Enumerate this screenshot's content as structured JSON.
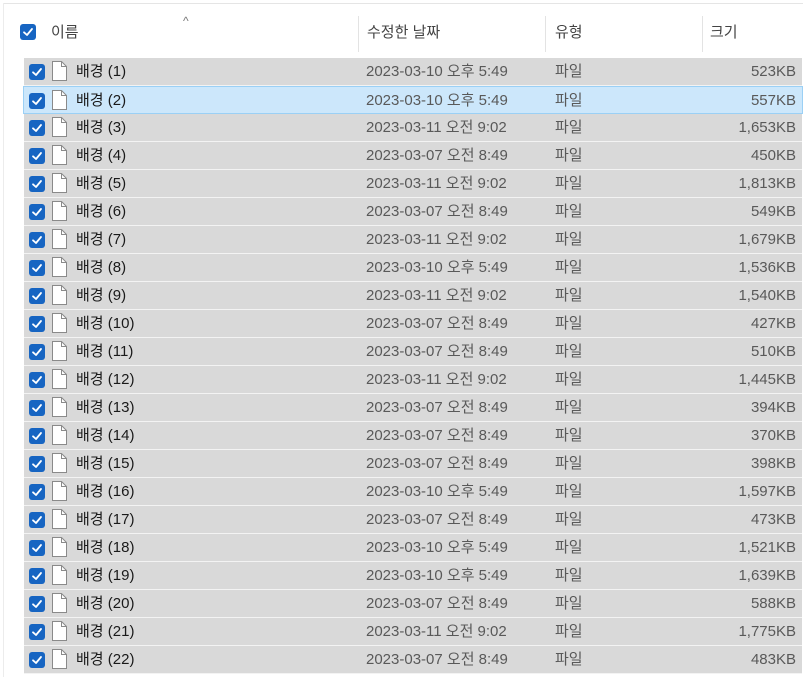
{
  "header": {
    "name": "이름",
    "date": "수정한 날짜",
    "type": "유형",
    "size": "크기"
  },
  "icons": {
    "sort": "chevron-up-icon",
    "checkbox": "checkbox-checked-icon",
    "file": "file-icon"
  },
  "colors": {
    "checkbox": "#1765c2",
    "selected_row": "#cce7fb",
    "row": "#d9d9d9"
  },
  "rows": [
    {
      "name": "배경 (1)",
      "date": "2023-03-10 오후 5:49",
      "type": "파일",
      "size": "523KB",
      "selected": false
    },
    {
      "name": "배경 (2)",
      "date": "2023-03-10 오후 5:49",
      "type": "파일",
      "size": "557KB",
      "selected": true
    },
    {
      "name": "배경 (3)",
      "date": "2023-03-11 오전 9:02",
      "type": "파일",
      "size": "1,653KB",
      "selected": false
    },
    {
      "name": "배경 (4)",
      "date": "2023-03-07 오전 8:49",
      "type": "파일",
      "size": "450KB",
      "selected": false
    },
    {
      "name": "배경 (5)",
      "date": "2023-03-11 오전 9:02",
      "type": "파일",
      "size": "1,813KB",
      "selected": false
    },
    {
      "name": "배경 (6)",
      "date": "2023-03-07 오전 8:49",
      "type": "파일",
      "size": "549KB",
      "selected": false
    },
    {
      "name": "배경 (7)",
      "date": "2023-03-11 오전 9:02",
      "type": "파일",
      "size": "1,679KB",
      "selected": false
    },
    {
      "name": "배경 (8)",
      "date": "2023-03-10 오후 5:49",
      "type": "파일",
      "size": "1,536KB",
      "selected": false
    },
    {
      "name": "배경 (9)",
      "date": "2023-03-11 오전 9:02",
      "type": "파일",
      "size": "1,540KB",
      "selected": false
    },
    {
      "name": "배경 (10)",
      "date": "2023-03-07 오전 8:49",
      "type": "파일",
      "size": "427KB",
      "selected": false
    },
    {
      "name": "배경 (11)",
      "date": "2023-03-07 오전 8:49",
      "type": "파일",
      "size": "510KB",
      "selected": false
    },
    {
      "name": "배경 (12)",
      "date": "2023-03-11 오전 9:02",
      "type": "파일",
      "size": "1,445KB",
      "selected": false
    },
    {
      "name": "배경 (13)",
      "date": "2023-03-07 오전 8:49",
      "type": "파일",
      "size": "394KB",
      "selected": false
    },
    {
      "name": "배경 (14)",
      "date": "2023-03-07 오전 8:49",
      "type": "파일",
      "size": "370KB",
      "selected": false
    },
    {
      "name": "배경 (15)",
      "date": "2023-03-07 오전 8:49",
      "type": "파일",
      "size": "398KB",
      "selected": false
    },
    {
      "name": "배경 (16)",
      "date": "2023-03-10 오후 5:49",
      "type": "파일",
      "size": "1,597KB",
      "selected": false
    },
    {
      "name": "배경 (17)",
      "date": "2023-03-07 오전 8:49",
      "type": "파일",
      "size": "473KB",
      "selected": false
    },
    {
      "name": "배경 (18)",
      "date": "2023-03-10 오후 5:49",
      "type": "파일",
      "size": "1,521KB",
      "selected": false
    },
    {
      "name": "배경 (19)",
      "date": "2023-03-10 오후 5:49",
      "type": "파일",
      "size": "1,639KB",
      "selected": false
    },
    {
      "name": "배경 (20)",
      "date": "2023-03-07 오전 8:49",
      "type": "파일",
      "size": "588KB",
      "selected": false
    },
    {
      "name": "배경 (21)",
      "date": "2023-03-11 오전 9:02",
      "type": "파일",
      "size": "1,775KB",
      "selected": false
    },
    {
      "name": "배경 (22)",
      "date": "2023-03-07 오전 8:49",
      "type": "파일",
      "size": "483KB",
      "selected": false
    }
  ]
}
